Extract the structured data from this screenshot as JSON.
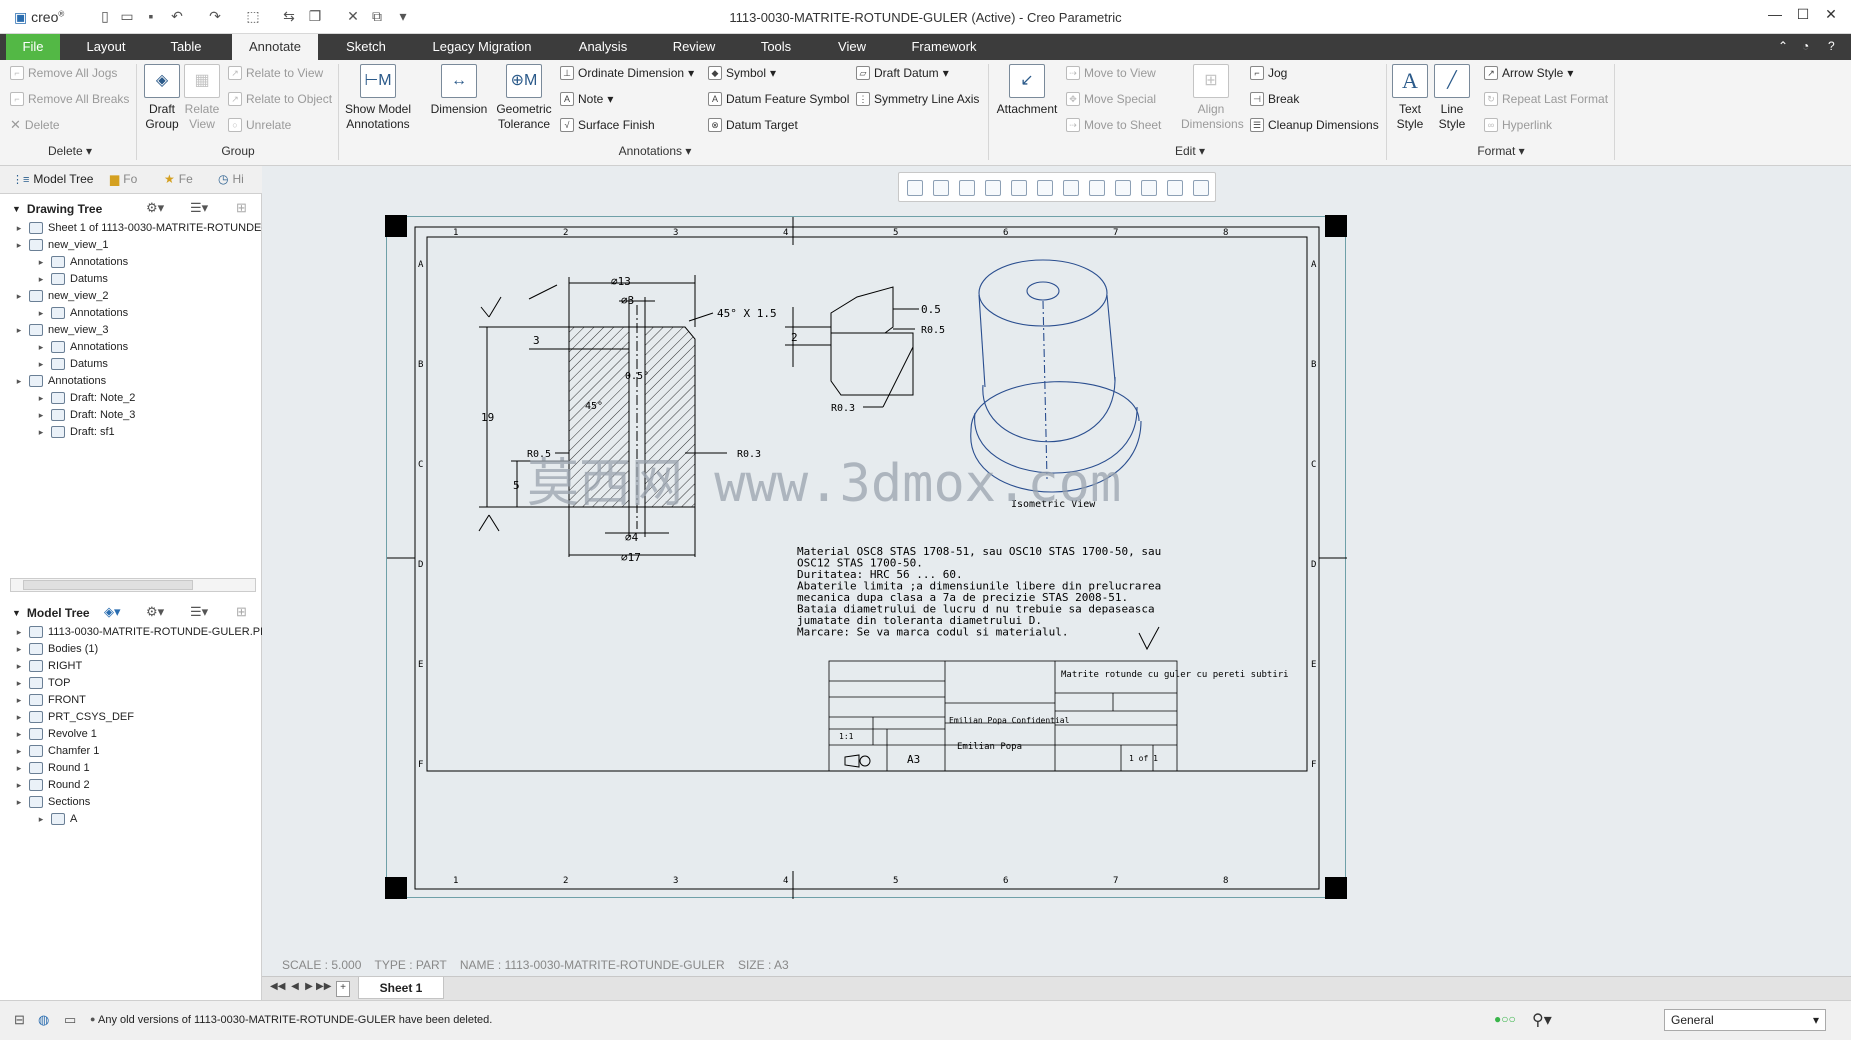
{
  "window": {
    "title": "1113-0030-MATRITE-ROTUNDE-GULER (Active) - Creo Parametric",
    "app": "creo"
  },
  "tabs": [
    "File",
    "Layout",
    "Table",
    "Annotate",
    "Sketch",
    "Legacy Migration",
    "Analysis",
    "Review",
    "Tools",
    "View",
    "Framework"
  ],
  "active_tab": "Annotate",
  "ribbon": {
    "delete": {
      "remove_jogs": "Remove All Jogs",
      "remove_breaks": "Remove All Breaks",
      "delete": "Delete",
      "group": "Delete"
    },
    "group": {
      "draft_group": "Draft Group",
      "relate_view": "Relate View",
      "relate_to_view": "Relate to View",
      "relate_to_object": "Relate to Object",
      "unrelate": "Unrelate",
      "group": "Group"
    },
    "annotations": {
      "show_model": "Show Model Annotations",
      "dimension": "Dimension",
      "geom_tol": "Geometric Tolerance",
      "ordinate": "Ordinate Dimension",
      "note": "Note",
      "surface_finish": "Surface Finish",
      "symbol": "Symbol",
      "datum_feature": "Datum Feature Symbol",
      "datum_target": "Datum Target",
      "draft_datum": "Draft Datum",
      "symmetry": "Symmetry Line Axis",
      "group": "Annotations"
    },
    "edit": {
      "attachment": "Attachment",
      "move_to_view": "Move to View",
      "move_special": "Move Special",
      "move_to_sheet": "Move to Sheet",
      "align_dims": "Align Dimensions",
      "jog": "Jog",
      "break": "Break",
      "cleanup": "Cleanup Dimensions",
      "group": "Edit"
    },
    "format": {
      "text_style": "Text Style",
      "line_style": "Line Style",
      "arrow_style": "Arrow Style",
      "repeat_last": "Repeat Last Format",
      "hyperlink": "Hyperlink",
      "group": "Format"
    }
  },
  "left_tabs": [
    "Model Tree",
    "Fo",
    "Fe",
    "Hi"
  ],
  "drawing_tree": {
    "header": "Drawing Tree",
    "items": [
      {
        "label": "Sheet 1 of 1113-0030-MATRITE-ROTUNDE-G",
        "level": 0
      },
      {
        "label": "new_view_1",
        "level": 0
      },
      {
        "label": "Annotations",
        "level": 1
      },
      {
        "label": "Datums",
        "level": 1
      },
      {
        "label": "new_view_2",
        "level": 0
      },
      {
        "label": "Annotations",
        "level": 1
      },
      {
        "label": "new_view_3",
        "level": 0
      },
      {
        "label": "Annotations",
        "level": 1
      },
      {
        "label": "Datums",
        "level": 1
      },
      {
        "label": "Annotations",
        "level": 0
      },
      {
        "label": "Draft: Note_2",
        "level": 1
      },
      {
        "label": "Draft: Note_3",
        "level": 1
      },
      {
        "label": "Draft: sf1",
        "level": 1
      }
    ]
  },
  "model_tree": {
    "header": "Model Tree",
    "items": [
      {
        "label": "1113-0030-MATRITE-ROTUNDE-GULER.PRT",
        "level": 0
      },
      {
        "label": "Bodies (1)",
        "level": 0
      },
      {
        "label": "RIGHT",
        "level": 0
      },
      {
        "label": "TOP",
        "level": 0
      },
      {
        "label": "FRONT",
        "level": 0
      },
      {
        "label": "PRT_CSYS_DEF",
        "level": 0
      },
      {
        "label": "Revolve 1",
        "level": 0
      },
      {
        "label": "Chamfer 1",
        "level": 0
      },
      {
        "label": "Round 1",
        "level": 0
      },
      {
        "label": "Round 2",
        "level": 0
      },
      {
        "label": "Sections",
        "level": 0
      },
      {
        "label": "A",
        "level": 1
      }
    ]
  },
  "drawing": {
    "dims": {
      "d13": "⌀13",
      "d3": "⌀3",
      "chamfer": "45° X 1.5",
      "h3": "3",
      "h19": "19",
      "h5": "5",
      "a05": "0.5°",
      "a45": "45°",
      "r05": "R0.5",
      "r03": "R0.3",
      "d4": "⌀4",
      "d17": "⌀17"
    },
    "detail": {
      "t05": "0.5",
      "t2": "2",
      "r05": "R0.5",
      "r03": "R0.3"
    },
    "iso_label": "Isometric View",
    "watermark": "莫西网 www.3dmox.com",
    "notes": [
      "Material OSC8 STAS 1708-51, sau OSC10 STAS 1700-50, sau",
      "OSC12 STAS 1700-50.",
      "Duritatea: HRC 56 ... 60.",
      "Abaterile limita ;a dimensiunile libere din prelucrarea",
      "mecanica dupa clasa a 7a de precizie STAS 2008-51.",
      "Bataia diametrului de lucru d nu trebuie sa depaseasca",
      "jumatate din toleranta diametrului D.",
      "Marcare: Se va marca codul si materialul."
    ],
    "title_block": {
      "description": "Matrite rotunde cu guler cu pereti subtiri",
      "author": "Emilian Popa",
      "confidential": "Emilian Popa Confidential",
      "size": "A3",
      "sheet": "1 of 1",
      "scale": "1:1"
    },
    "border_numbers": [
      "1",
      "2",
      "3",
      "4",
      "5",
      "6",
      "7",
      "8"
    ],
    "border_letters": [
      "A",
      "B",
      "C",
      "D",
      "E",
      "F"
    ]
  },
  "statusline": {
    "scale": "SCALE : 5.000",
    "type": "TYPE : PART",
    "name": "NAME : 1113-0030-MATRITE-ROTUNDE-GULER",
    "size": "SIZE : A3"
  },
  "sheet_tab": "Sheet 1",
  "status_message": "Any old versions of 1113-0030-MATRITE-ROTUNDE-GULER have been deleted.",
  "filter": "General"
}
